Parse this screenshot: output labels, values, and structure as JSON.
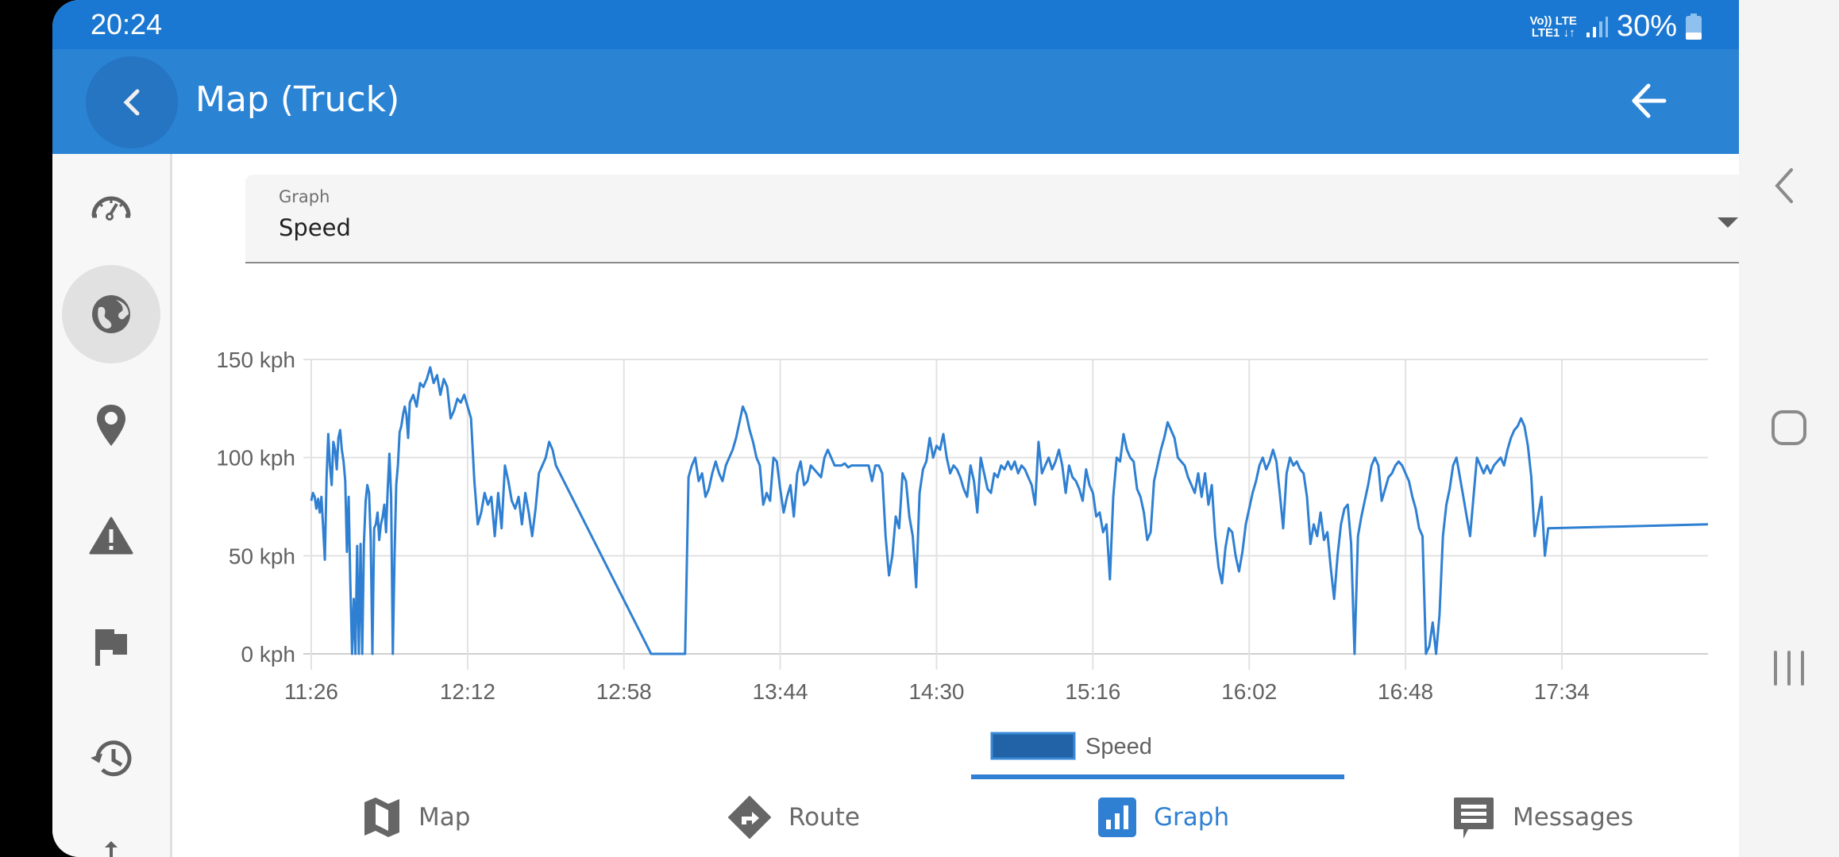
{
  "status_bar": {
    "time": "20:24",
    "network_top": "Vo)) LTE",
    "network_bottom": "LTE1 ↓↑",
    "battery_percent": "30%",
    "battery_level": 0.3
  },
  "app_bar": {
    "title": "Map (Truck)",
    "back_icon": "chevron-left-icon",
    "action_icon": "arrow-left-icon"
  },
  "sidebar": {
    "items": [
      {
        "name": "dashboard",
        "icon": "speedometer-icon",
        "active": false
      },
      {
        "name": "globe",
        "icon": "globe-icon",
        "active": true
      },
      {
        "name": "location",
        "icon": "map-pin-icon",
        "active": false
      },
      {
        "name": "alerts",
        "icon": "warning-icon",
        "active": false
      },
      {
        "name": "flags",
        "icon": "flag-icon",
        "active": false
      },
      {
        "name": "history",
        "icon": "history-icon",
        "active": false
      },
      {
        "name": "more",
        "icon": "arrow-up-icon",
        "active": false
      }
    ]
  },
  "graph_select": {
    "label": "Graph",
    "value": "Speed"
  },
  "colors": {
    "accent": "#2f80d2",
    "status_bar": "#1b78d2",
    "app_bar": "#2b83d4",
    "series": "#2f80d2",
    "legend_fill": "#2163a6"
  },
  "chart_data": {
    "type": "line",
    "title": "",
    "xlabel": "",
    "ylabel": "",
    "x_unit": "minutes since 11:26",
    "y_unit": "kph",
    "ylim": [
      0,
      150
    ],
    "xlim": [
      0,
      411
    ],
    "y_ticks": [
      0,
      50,
      100,
      150
    ],
    "y_tick_labels": [
      "0 kph",
      "50 kph",
      "100 kph",
      "150 kph"
    ],
    "x_ticks": [
      0,
      46,
      92,
      138,
      184,
      230,
      276,
      322,
      368
    ],
    "x_tick_labels": [
      "11:26",
      "12:12",
      "12:58",
      "13:44",
      "14:30",
      "15:16",
      "16:02",
      "16:48",
      "17:34"
    ],
    "grid": true,
    "legend": {
      "position": "bottom-center",
      "entries": [
        "Speed"
      ]
    },
    "series": [
      {
        "name": "Speed",
        "x": [
          0,
          0.5,
          1,
          1.5,
          2,
          2.5,
          3,
          3.5,
          4,
          4.5,
          5,
          5.5,
          6,
          6.5,
          7,
          7.5,
          8,
          8.5,
          9,
          9.5,
          10,
          10.5,
          11,
          11.5,
          12,
          12.5,
          13,
          13.5,
          14,
          14.5,
          15,
          15.5,
          16,
          16.5,
          17,
          17.5,
          18,
          18.5,
          19,
          19.5,
          20,
          20.5,
          21,
          21.5,
          22,
          22.5,
          23,
          23.5,
          24,
          24.5,
          25,
          25.5,
          26,
          26.5,
          27,
          27.5,
          28,
          28.5,
          29,
          29.5,
          30,
          31,
          32,
          33,
          34,
          35,
          36,
          37,
          38,
          39,
          40,
          41,
          42,
          43,
          44,
          45,
          46,
          47,
          48,
          49,
          50,
          51,
          52,
          53,
          54,
          55,
          56,
          57,
          58,
          59,
          60,
          61,
          62,
          63,
          64,
          65,
          66,
          67,
          68,
          69,
          70,
          71,
          72,
          100,
          108,
          109,
          110,
          111,
          112,
          113,
          114,
          115,
          116,
          117,
          118,
          119,
          120,
          121,
          122,
          123,
          124,
          125,
          126,
          127,
          128,
          129,
          130,
          131,
          132,
          133,
          134,
          135,
          136,
          137,
          138,
          139,
          140,
          141,
          142,
          143,
          144,
          145,
          146,
          147,
          148,
          149,
          150,
          151,
          152,
          153,
          154,
          155,
          156,
          157,
          158,
          159,
          160,
          161,
          162,
          163,
          164,
          165,
          166,
          167,
          168,
          169,
          170,
          171,
          172,
          173,
          174,
          175,
          176,
          177,
          178,
          179,
          180,
          181,
          182,
          183,
          184,
          185,
          186,
          187,
          188,
          189,
          190,
          191,
          192,
          193,
          194,
          195,
          196,
          197,
          198,
          199,
          200,
          201,
          202,
          203,
          204,
          205,
          206,
          207,
          208,
          209,
          210,
          211,
          212,
          213,
          214,
          215,
          216,
          217,
          218,
          219,
          220,
          221,
          222,
          223,
          224,
          225,
          226,
          227,
          228,
          229,
          230,
          231,
          232,
          233,
          234,
          235,
          236,
          237,
          238,
          239,
          240,
          241,
          242,
          243,
          244,
          245,
          246,
          247,
          248,
          249,
          250,
          251,
          252,
          253,
          254,
          255,
          256,
          257,
          258,
          259,
          260,
          261,
          262,
          263,
          264,
          265,
          266,
          267,
          268,
          269,
          270,
          271,
          272,
          273,
          274,
          275,
          276,
          277,
          278,
          279,
          280,
          281,
          282,
          283,
          284,
          285,
          286,
          287,
          288,
          289,
          290,
          291,
          292,
          293,
          294,
          295,
          296,
          297,
          298,
          299,
          300,
          301,
          302,
          303,
          304,
          305,
          306,
          307,
          308,
          309,
          310,
          311,
          312,
          313,
          314,
          315,
          316,
          317,
          318,
          319,
          320,
          321,
          322,
          323,
          324,
          325,
          326,
          327,
          328,
          329,
          330,
          331,
          332,
          333,
          334,
          335,
          336,
          337,
          338,
          339,
          340,
          341,
          342,
          343,
          344,
          345,
          346,
          347,
          348,
          349,
          350,
          351,
          352,
          353,
          354,
          355,
          356,
          357,
          358,
          359,
          360,
          361,
          362,
          363,
          364,
          411
        ],
        "y": [
          78,
          82,
          80,
          74,
          79,
          72,
          80,
          64,
          48,
          90,
          112,
          96,
          86,
          108,
          104,
          94,
          110,
          114,
          104,
          98,
          88,
          52,
          80,
          36,
          0,
          28,
          0,
          55,
          0,
          56,
          0,
          56,
          78,
          86,
          82,
          58,
          0,
          64,
          66,
          72,
          58,
          66,
          70,
          76,
          62,
          84,
          102,
          80,
          0,
          50,
          86,
          96,
          113,
          116,
          122,
          126,
          122,
          110,
          128,
          130,
          132,
          126,
          138,
          136,
          140,
          146,
          138,
          142,
          132,
          140,
          136,
          120,
          124,
          130,
          128,
          132,
          126,
          120,
          88,
          66,
          72,
          82,
          76,
          80,
          60,
          82,
          64,
          96,
          88,
          78,
          74,
          80,
          66,
          82,
          72,
          60,
          74,
          92,
          96,
          100,
          108,
          104,
          96,
          0,
          0,
          0,
          0,
          90,
          96,
          100,
          88,
          92,
          80,
          84,
          92,
          98,
          92,
          88,
          96,
          100,
          104,
          110,
          118,
          126,
          122,
          114,
          108,
          100,
          96,
          76,
          82,
          78,
          100,
          98,
          84,
          72,
          80,
          86,
          70,
          92,
          98,
          86,
          88,
          96,
          94,
          92,
          90,
          100,
          104,
          100,
          96,
          96,
          96,
          97,
          95,
          96,
          96,
          96,
          96,
          96,
          96,
          88,
          96,
          96,
          92,
          60,
          40,
          50,
          70,
          64,
          92,
          88,
          70,
          60,
          34,
          82,
          94,
          98,
          110,
          100,
          106,
          104,
          112,
          100,
          92,
          96,
          94,
          90,
          84,
          80,
          96,
          88,
          72,
          100,
          92,
          84,
          82,
          92,
          90,
          96,
          94,
          98,
          94,
          98,
          92,
          96,
          94,
          90,
          86,
          76,
          108,
          92,
          96,
          100,
          94,
          98,
          104,
          96,
          82,
          96,
          90,
          88,
          84,
          78,
          94,
          86,
          82,
          70,
          72,
          62,
          66,
          38,
          80,
          100,
          98,
          112,
          104,
          100,
          98,
          84,
          80,
          72,
          58,
          62,
          88,
          96,
          104,
          110,
          118,
          114,
          110,
          100,
          98,
          96,
          90,
          86,
          82,
          92,
          80,
          92,
          76,
          86,
          60,
          44,
          36,
          54,
          64,
          62,
          50,
          42,
          52,
          66,
          74,
          82,
          88,
          96,
          100,
          94,
          98,
          104,
          98,
          82,
          64,
          92,
          100,
          96,
          98,
          94,
          92,
          80,
          56,
          66,
          60,
          72,
          58,
          62,
          44,
          28,
          50,
          66,
          74,
          76,
          56,
          0,
          60,
          70,
          78,
          86,
          96,
          100,
          96,
          78,
          84,
          90,
          92,
          96,
          98,
          96,
          92,
          88,
          80,
          74,
          64,
          60,
          0,
          4,
          16,
          0,
          20,
          60,
          76,
          84,
          96,
          100,
          90,
          80,
          70,
          60,
          80,
          100,
          96,
          92,
          96,
          92,
          96,
          98,
          100,
          96,
          104,
          110,
          114,
          116,
          120,
          116,
          106,
          90,
          60,
          70,
          80,
          50,
          64,
          66,
          94,
          100,
          110,
          116,
          120,
          122,
          110,
          86,
          96,
          100,
          100,
          92,
          62,
          40,
          28,
          80,
          82,
          92,
          100,
          100,
          98,
          98,
          98,
          96,
          98,
          96,
          96,
          96,
          98,
          96,
          90,
          80,
          88,
          100,
          106,
          116,
          120,
          104,
          66,
          58,
          70,
          90,
          84,
          72,
          0
        ],
        "color": "#2f80d2"
      }
    ]
  },
  "legend": {
    "label": "Speed"
  },
  "tabs": {
    "items": [
      {
        "label": "Map",
        "icon": "map-icon",
        "active": false
      },
      {
        "label": "Route",
        "icon": "route-icon",
        "active": false
      },
      {
        "label": "Graph",
        "icon": "bar-chart-icon",
        "active": true
      },
      {
        "label": "Messages",
        "icon": "message-icon",
        "active": false
      }
    ],
    "close_icon": "close-icon"
  },
  "system_nav": {
    "back_icon": "back-icon",
    "home_icon": "home-icon",
    "recents_icon": "recents-icon"
  }
}
